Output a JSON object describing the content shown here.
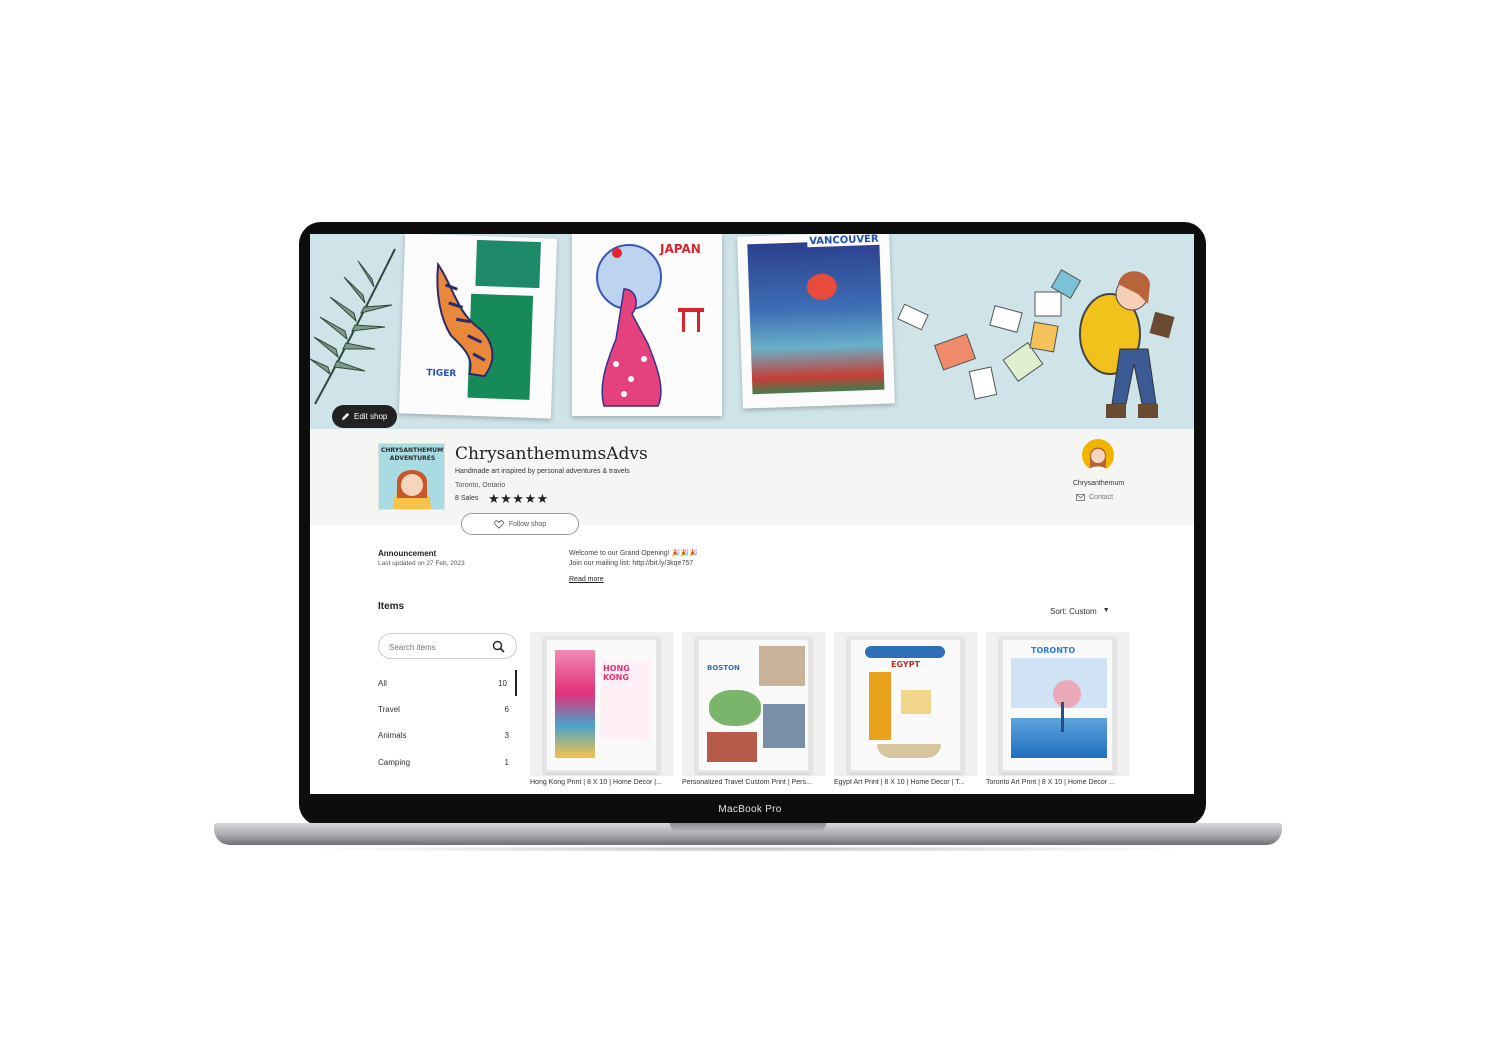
{
  "device": {
    "label": "MacBook Pro"
  },
  "banner": {
    "card_tiger": "TIGER",
    "card_japan": "JAPAN",
    "card_vancouver": "VANCOUVER",
    "edit_shop_label": "Edit shop"
  },
  "shop": {
    "name": "ChrysanthemumsAdvs",
    "tagline": "Handmade art inspired by personal adventures & travels",
    "location": "Toronto, Ontario",
    "sales": "8 Sales",
    "rating_stars": "★★★★★",
    "follow_label": "Follow shop",
    "logo_text": "CHRYSANTHEMUM'S ADVENTURES"
  },
  "owner": {
    "name": "Chrysanthemum",
    "contact_label": "Contact"
  },
  "announcement": {
    "title": "Announcement",
    "updated": "Last updated on 27 Feb, 2023",
    "line1": "Welcome to our Grand Opening! 🎉🎉🎉",
    "line2": "Join our mailing list: http://bit.ly/3kqe757",
    "read_more": "Read more"
  },
  "items": {
    "title": "Items",
    "sort_label": "Sort: Custom",
    "search_placeholder": "Search items",
    "categories": [
      {
        "label": "All",
        "count": "10"
      },
      {
        "label": "Travel",
        "count": "6"
      },
      {
        "label": "Animals",
        "count": "3"
      },
      {
        "label": "Camping",
        "count": "1"
      }
    ],
    "listings": [
      {
        "title": "Hong Kong Print | 8 X 10 | Home Decor |...",
        "art_text": "HONG KONG",
        "accent": "#e2307a"
      },
      {
        "title": "Personalized Travel Custom Print | Pers...",
        "art_text": "BOSTON",
        "accent": "#3a6fb0"
      },
      {
        "title": "Egypt Art Print | 8 X 10 | Home Decor | T...",
        "art_text": "EGYPT",
        "accent": "#e8a21b"
      },
      {
        "title": "Toronto Art Print | 8 X 10 | Home Decor ...",
        "art_text": "TORONTO",
        "accent": "#2f7fd0"
      }
    ]
  },
  "colors": {
    "banner_bg": "#cfe4e8",
    "header_bg": "#f5f5f4",
    "accent_dark": "#222222"
  }
}
